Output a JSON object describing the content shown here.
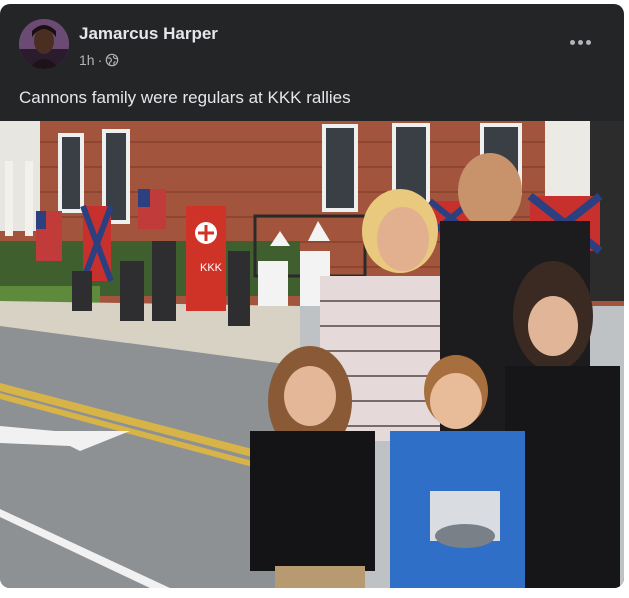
{
  "post": {
    "author_name": "Jamarcus Harper",
    "timestamp": "1h",
    "separator": "·",
    "audience_icon": "globe-icon",
    "more_icon": "more-options-icon",
    "caption": "Cannons family were regulars at KKK rallies"
  },
  "photo": {
    "flag_text": "KKK"
  },
  "colors": {
    "card_bg": "#242526",
    "primary_text": "#e4e6eb",
    "secondary_text": "#b0b3b8"
  }
}
